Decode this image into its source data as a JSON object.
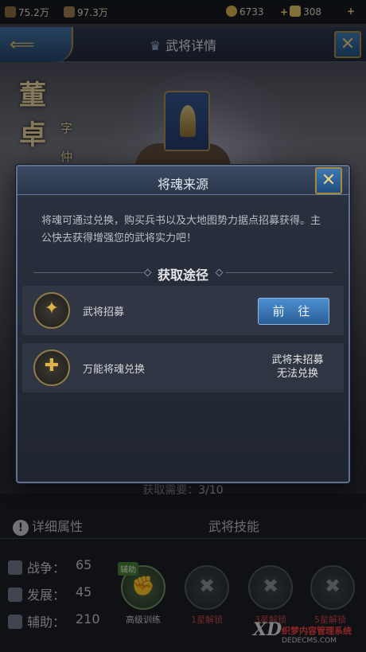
{
  "topbar": {
    "resource1": "75.2万",
    "resource2": "97.3万",
    "coins": "6733",
    "gold": "308"
  },
  "header": {
    "title": "武将详情"
  },
  "hero": {
    "name_char1": "董",
    "name_char2": "卓",
    "style_char1": "字",
    "style_char2": "仲"
  },
  "modal": {
    "title": "将魂来源",
    "description": "将魂可通过兑换，购买兵书以及大地图势力据点招募获得。主公快去获得增强您的武将实力吧！",
    "section_title": "获取途径",
    "rows": [
      {
        "label": "武将招募",
        "action": "前 往"
      },
      {
        "label": "万能将魂兑换",
        "status_line1": "武将未招募",
        "status_line2": "无法兑换"
      }
    ]
  },
  "lower": {
    "need_label": "获取需要：",
    "need_value": "3/10",
    "tab_attrs": "详细属性",
    "tab_skills": "武将技能",
    "stats": [
      {
        "label": "战争：",
        "value": "65"
      },
      {
        "label": "发展：",
        "value": "45"
      },
      {
        "label": "辅助：",
        "value": "210"
      }
    ],
    "skills": [
      {
        "badge": "辅助",
        "label": "高级训练"
      },
      {
        "label": "1星解锁"
      },
      {
        "label": "3星解锁"
      },
      {
        "label": "5星解锁"
      }
    ]
  },
  "watermark": {
    "brand": "XD",
    "line1": "织梦内容管理系统",
    "line2": "DEDECMS.COM"
  },
  "colors": {
    "accent_gold": "#a8883c",
    "button_blue": "#3b78b4",
    "locked_red": "#c94040"
  }
}
